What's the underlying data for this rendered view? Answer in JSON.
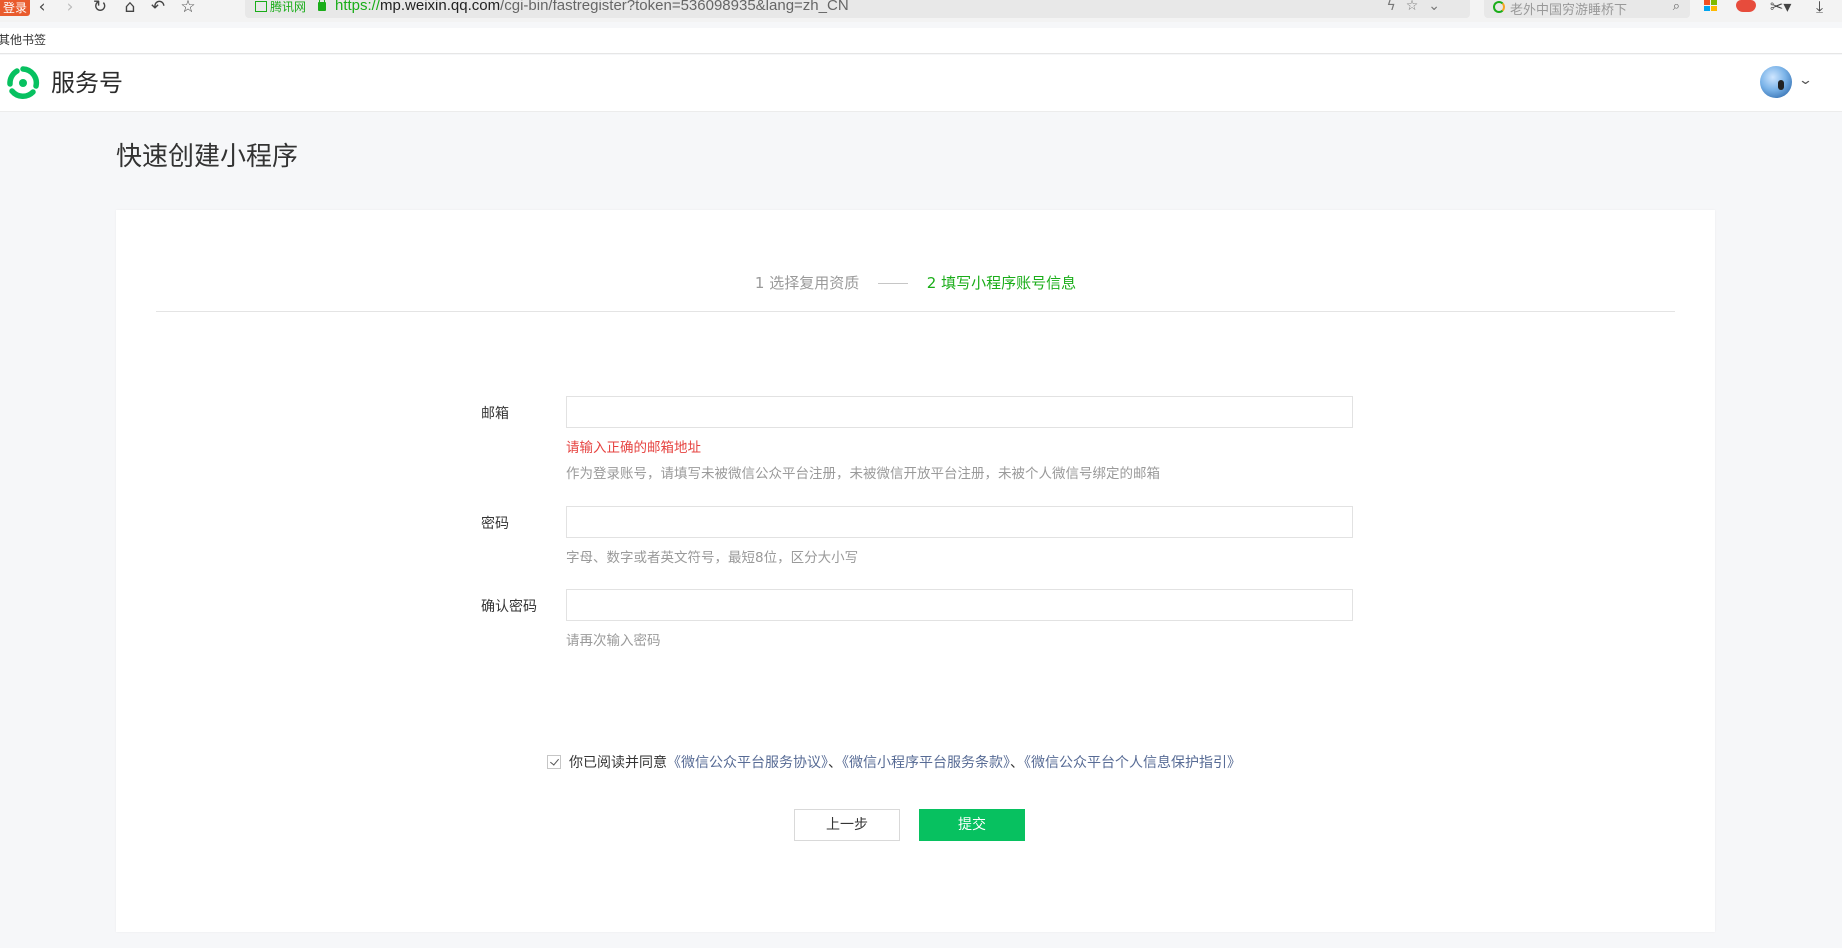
{
  "browser": {
    "login_badge": "登录",
    "address": {
      "cert_label": "腾讯网",
      "url_protocol": "https://",
      "url_host": "mp.weixin.qq.com",
      "url_path": "/cgi-bin/fastregister?token=536098935&lang=zh_CN"
    },
    "search_placeholder": "老外中国穷游睡桥下",
    "bookmark": "其他书签"
  },
  "header": {
    "site_name": "服务号"
  },
  "page": {
    "title": "快速创建小程序"
  },
  "steps": {
    "step1": "1 选择复用资质",
    "step2": "2 填写小程序账号信息"
  },
  "form": {
    "email": {
      "label": "邮箱",
      "value": "",
      "error": "请输入正确的邮箱地址",
      "tip": "作为登录账号，请填写未被微信公众平台注册，未被微信开放平台注册，未被个人微信号绑定的邮箱"
    },
    "password": {
      "label": "密码",
      "value": "",
      "tip": "字母、数字或者英文符号，最短8位，区分大小写"
    },
    "confirm_password": {
      "label": "确认密码",
      "value": "",
      "tip": "请再次输入密码"
    }
  },
  "agreement": {
    "checked": true,
    "prefix": "你已阅读并同意",
    "link1": "《微信公众平台服务协议》",
    "sep1": "、",
    "link2": "《微信小程序平台服务条款》",
    "sep2": "、",
    "link3": "《微信公众平台个人信息保护指引》"
  },
  "buttons": {
    "prev": "上一步",
    "submit": "提交"
  },
  "colors": {
    "brand_green": "#07c160",
    "step_active": "#1aad19",
    "error_red": "#e64340",
    "link_blue": "#576b95"
  }
}
